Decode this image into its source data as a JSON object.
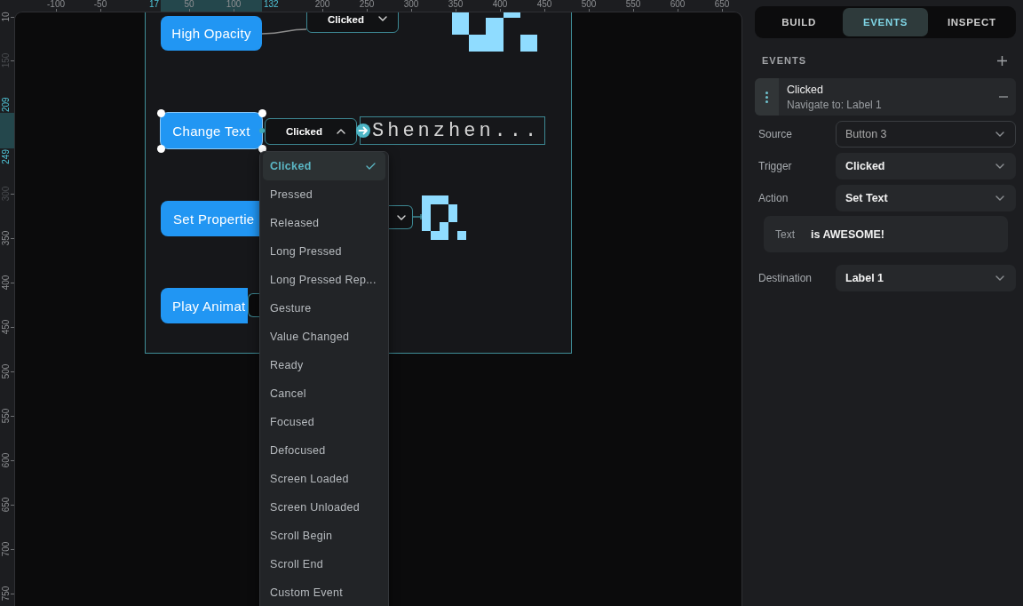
{
  "rulers": {
    "top": [
      {
        "label": "-100",
        "kind": "tick"
      },
      {
        "label": "-50",
        "kind": "tick"
      },
      {
        "label": "17",
        "kind": "marker"
      },
      {
        "label": "50",
        "kind": "tick"
      },
      {
        "label": "100",
        "kind": "tick"
      },
      {
        "label": "132",
        "kind": "marker"
      },
      {
        "label": "200",
        "kind": "tick"
      },
      {
        "label": "250",
        "kind": "tick"
      },
      {
        "label": "300",
        "kind": "tick"
      },
      {
        "label": "350",
        "kind": "tick"
      },
      {
        "label": "400",
        "kind": "tick"
      },
      {
        "label": "450",
        "kind": "tick"
      },
      {
        "label": "500",
        "kind": "tick"
      },
      {
        "label": "550",
        "kind": "tick"
      },
      {
        "label": "600",
        "kind": "tick"
      },
      {
        "label": "650",
        "kind": "tick"
      }
    ],
    "left": [
      {
        "label": "10",
        "kind": "tick"
      },
      {
        "label": "150",
        "kind": "faded"
      },
      {
        "label": "209",
        "kind": "marker"
      },
      {
        "label": "249",
        "kind": "marker"
      },
      {
        "label": "300",
        "kind": "faded"
      },
      {
        "label": "350",
        "kind": "tick"
      },
      {
        "label": "400",
        "kind": "tick"
      },
      {
        "label": "450",
        "kind": "tick"
      },
      {
        "label": "500",
        "kind": "tick"
      },
      {
        "label": "550",
        "kind": "tick"
      },
      {
        "label": "600",
        "kind": "tick"
      },
      {
        "label": "650",
        "kind": "tick"
      },
      {
        "label": "700",
        "kind": "tick"
      },
      {
        "label": "750",
        "kind": "tick"
      }
    ]
  },
  "canvas": {
    "buttons": [
      {
        "label": "High Opacity",
        "selected": false
      },
      {
        "label": "Change Text",
        "selected": true
      },
      {
        "label": "Set Propertie",
        "selected": false
      },
      {
        "label": "Play Animat",
        "selected": false
      }
    ],
    "event_dropdowns": [
      {
        "value": "Clicked",
        "expanded": false
      },
      {
        "value": "Clicked",
        "expanded": true
      },
      {
        "expanded": false
      }
    ],
    "label_widget": {
      "text": "Shenzhen..."
    },
    "event_menu": {
      "items": [
        {
          "label": "Clicked",
          "selected": true
        },
        {
          "label": "Pressed",
          "selected": false
        },
        {
          "label": "Released",
          "selected": false
        },
        {
          "label": "Long Pressed",
          "selected": false
        },
        {
          "label": "Long Pressed Rep...",
          "selected": false
        },
        {
          "label": "Gesture",
          "selected": false
        },
        {
          "label": "Value Changed",
          "selected": false
        },
        {
          "label": "Ready",
          "selected": false
        },
        {
          "label": "Cancel",
          "selected": false
        },
        {
          "label": "Focused",
          "selected": false
        },
        {
          "label": "Defocused",
          "selected": false
        },
        {
          "label": "Screen Loaded",
          "selected": false
        },
        {
          "label": "Screen Unloaded",
          "selected": false
        },
        {
          "label": "Scroll Begin",
          "selected": false
        },
        {
          "label": "Scroll End",
          "selected": false
        },
        {
          "label": "Custom Event",
          "selected": false
        }
      ]
    }
  },
  "panel": {
    "tabs": [
      {
        "label": "BUILD",
        "selected": false
      },
      {
        "label": "EVENTS",
        "selected": true
      },
      {
        "label": "INSPECT",
        "selected": false
      }
    ],
    "events_header": {
      "title": "EVENTS"
    },
    "event_card": {
      "title": "Clicked",
      "subtitle": "Navigate to: Label 1"
    },
    "fields": [
      {
        "kind": "select",
        "label": "Source",
        "value": "Button 3",
        "disabled": true
      },
      {
        "kind": "select",
        "label": "Trigger",
        "value": "Clicked",
        "disabled": false
      },
      {
        "kind": "select",
        "label": "Action",
        "value": "Set Text",
        "disabled": false
      },
      {
        "kind": "text",
        "label": "Text",
        "value": "is AWESOME!"
      },
      {
        "kind": "select",
        "label": "Destination",
        "value": "Label 1",
        "disabled": false
      }
    ]
  }
}
